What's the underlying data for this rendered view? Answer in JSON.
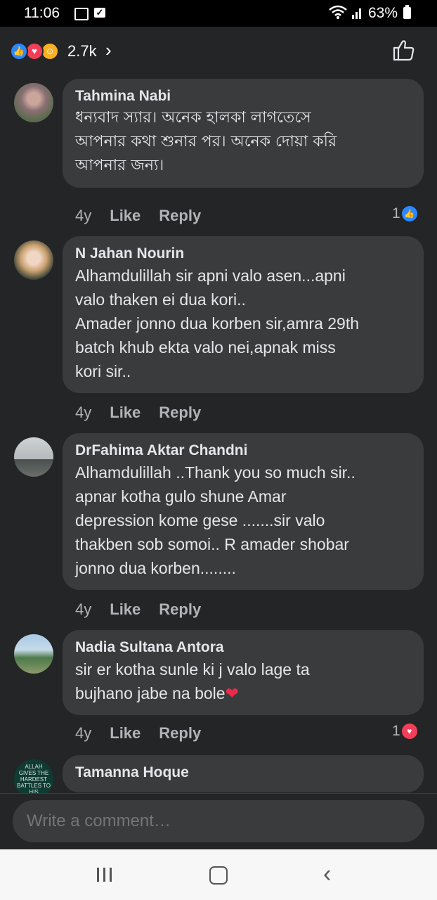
{
  "status_bar": {
    "time": "11:06",
    "battery": "63%"
  },
  "reactions": {
    "count": "2.7k"
  },
  "comments": [
    {
      "name": "Tahmina Nabi",
      "lines": [
        "ধন্যবাদ স্যার। অনেক হালকা লাগতেসে",
        "আপনার কথা শুনার পর। অনেক দোয়া করি",
        "আপনার জন্য।"
      ],
      "time": "4y",
      "like": "Like",
      "reply": "Reply",
      "react_count": "1"
    },
    {
      "name": "N Jahan Nourin",
      "lines": [
        "Alhamdulillah sir apni valo asen...apni",
        "valo thaken ei dua kori..",
        "Amader jonno dua korben sir,amra 29th",
        "batch khub ekta valo nei,apnak miss",
        "kori sir.."
      ],
      "time": "4y",
      "like": "Like",
      "reply": "Reply"
    },
    {
      "name": "DrFahima Aktar Chandni",
      "lines": [
        "Alhamdulillah ..Thank you so much sir..",
        "apnar kotha gulo shune Amar",
        "depression kome gese .......sir valo",
        "thakben sob somoi.. R amader shobar",
        "jonno dua korben........"
      ],
      "time": "4y",
      "like": "Like",
      "reply": "Reply"
    },
    {
      "name": "Nadia Sultana Antora",
      "lines": [
        "sir er kotha sunle ki j valo lage ta",
        "bujhano jabe na bole"
      ],
      "time": "4y",
      "like": "Like",
      "reply": "Reply",
      "react_count": "1"
    },
    {
      "name": "Tamanna Hoque",
      "avatar_text": "ALLAH GIVES THE HARDEST BATTLES TO HIS"
    }
  ],
  "composer": {
    "placeholder": "Write a comment…"
  },
  "icons": [
    "image-icon",
    "check-icon",
    "wifi-icon",
    "signal-icon",
    "battery-icon",
    "like-reaction-icon",
    "love-reaction-icon",
    "care-reaction-icon",
    "thumbs-up-icon",
    "heart-icon",
    "recent-apps-icon",
    "home-icon",
    "back-icon"
  ]
}
